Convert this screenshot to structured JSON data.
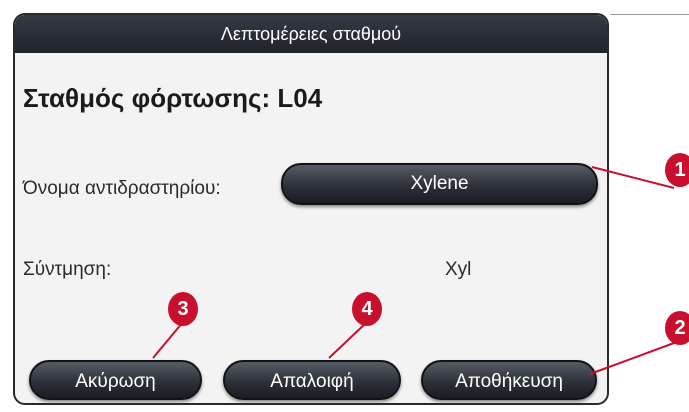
{
  "dialog": {
    "title": "Λεπτομέρειες σταθμού",
    "station_heading": "Σταθμός φόρτωσης: L04",
    "reagent_label": "Όνομα αντιδραστηρίου:",
    "reagent_value": "Xylene",
    "abbreviation_label": "Σύντμηση:",
    "abbreviation_value": "Xyl"
  },
  "buttons": {
    "cancel": "Ακύρωση",
    "clear": "Απαλοιφή",
    "save": "Αποθήκευση"
  },
  "callouts": {
    "reagent": "1",
    "save": "2",
    "cancel": "3",
    "clear": "4"
  },
  "colors": {
    "titlebar": "#1f232a",
    "button": "#2d3138",
    "callout": "#c8102e",
    "dialog_bg": "#f3f3f3"
  }
}
